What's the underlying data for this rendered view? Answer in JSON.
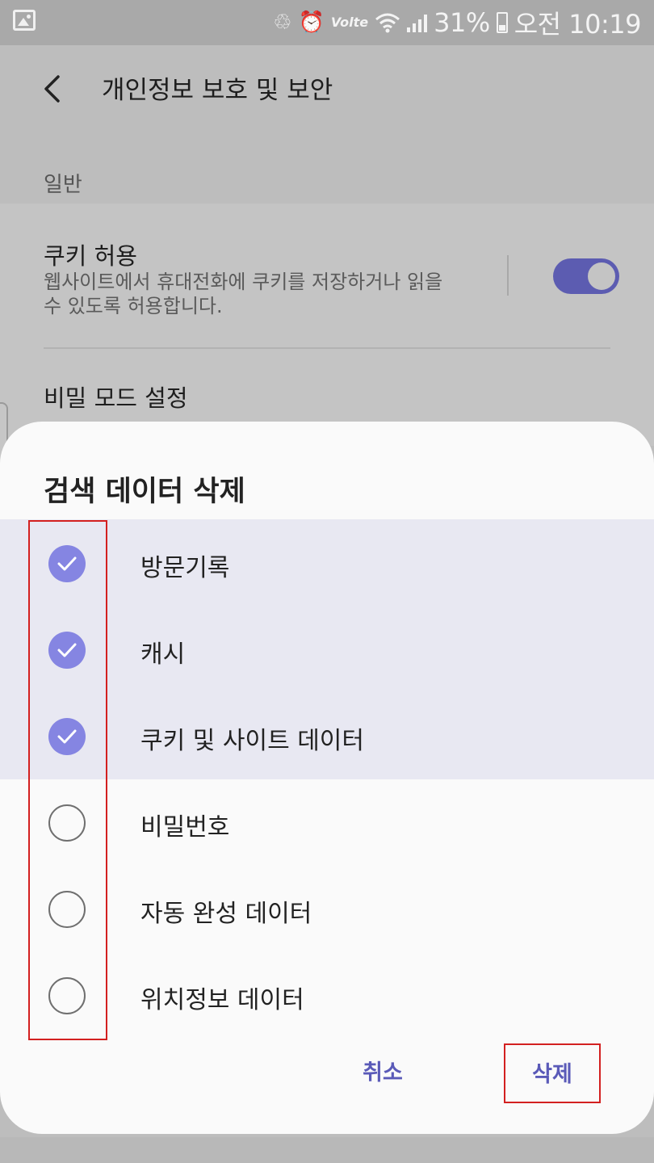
{
  "status_bar": {
    "battery_percent": "31%",
    "time": "오전 10:19",
    "network": "Volte",
    "icons": [
      "gallery-icon",
      "sync-icon",
      "alarm-icon",
      "volte-icon",
      "wifi-icon",
      "signal-icon",
      "battery-icon"
    ]
  },
  "app_bar": {
    "title": "개인정보 보호 및 보안"
  },
  "settings": {
    "section_general": "일반",
    "cookie_title": "쿠키 허용",
    "cookie_desc": "웹사이트에서 휴대전화에 쿠키를 저장하거나 읽을 수 있도록 허용합니다.",
    "cookie_enabled": true,
    "secret_mode_title": "비밀 모드 설정"
  },
  "dialog": {
    "title": "검색 데이터 삭제",
    "options": [
      {
        "label": "방문기록",
        "checked": true
      },
      {
        "label": "캐시",
        "checked": true
      },
      {
        "label": "쿠키 및 사이트 데이터",
        "checked": true
      },
      {
        "label": "비밀번호",
        "checked": false
      },
      {
        "label": "자동 완성 데이터",
        "checked": false
      },
      {
        "label": "위치정보 데이터",
        "checked": false
      }
    ],
    "cancel_label": "취소",
    "delete_label": "삭제"
  },
  "colors": {
    "accent": "#5a5ab8",
    "check_fill": "#8585e2",
    "highlight": "#d32020"
  }
}
